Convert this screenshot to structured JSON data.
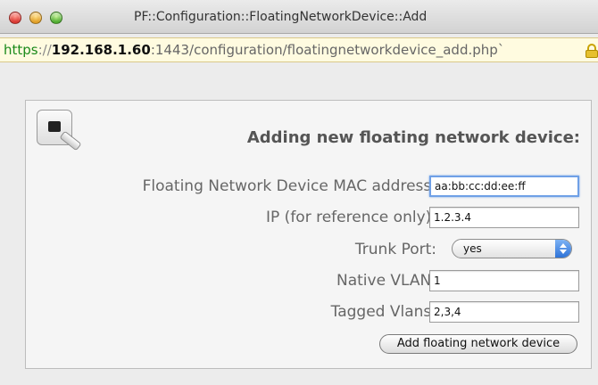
{
  "window": {
    "title": "PF::Configuration::FloatingNetworkDevice::Add"
  },
  "url": {
    "scheme": "https",
    "separator": "://",
    "host": "192.168.1.60",
    "rest": ":1443/configuration/floatingnetworkdevice_add.php`"
  },
  "form": {
    "heading": "Adding new floating network device:",
    "mac_label": "Floating Network Device MAC address:",
    "mac_value": "aa:bb:cc:dd:ee:ff",
    "ip_label": "IP (for reference only):",
    "ip_value": "1.2.3.4",
    "trunk_label": "Trunk Port:",
    "trunk_value": "yes",
    "native_vlan_label": "Native VLAN:",
    "native_vlan_value": "1",
    "tagged_vlans_label": "Tagged Vlans:",
    "tagged_vlans_value": "2,3,4",
    "submit_label": "Add floating network device"
  },
  "icons": {
    "window_controls": [
      "close-icon",
      "minimize-icon",
      "zoom-icon"
    ],
    "device": "network-device-icon",
    "lock": "lock-icon"
  },
  "colors": {
    "url_scheme": "#1b8a1b",
    "url_bar_bg": "#fffbe0",
    "focus_ring": "#6fa0e6"
  }
}
